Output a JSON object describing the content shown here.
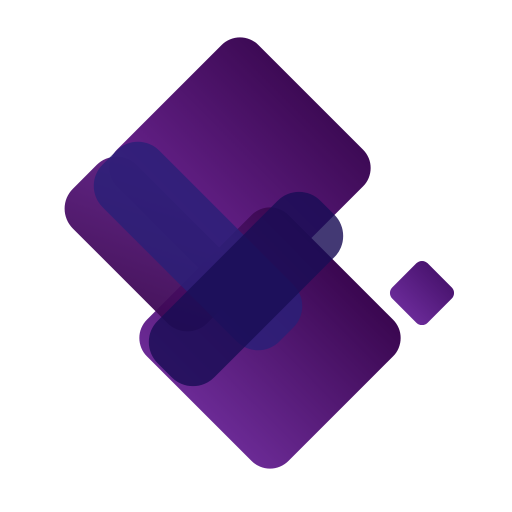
{
  "logo": {
    "name": "power-apps-logo",
    "colors": {
      "background": "#ffffff",
      "top_square_dark": "#3d0a55",
      "top_square_light": "#6a2490",
      "bottom_square_dark": "#3a0750",
      "bottom_square_light": "#6b2a95",
      "overlay_blue": "#2a2078",
      "overlay_navy": "#1a0d55",
      "small_square": "#5a1f8a"
    }
  }
}
